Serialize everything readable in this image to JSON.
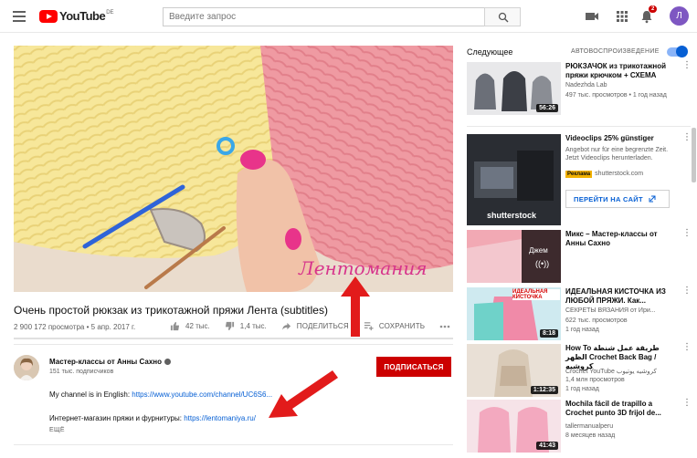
{
  "header": {
    "logo_text": "YouTube",
    "logo_region": "DE",
    "search_placeholder": "Введите запрос",
    "notification_count": "2",
    "avatar_letter": "Л",
    "colors": {
      "brand": "#ff0000",
      "avatar": "#7e57c2"
    }
  },
  "video": {
    "watermark": "Лентомания",
    "title": "Очень простой рюкзак из трикотажной пряжи Лента (subtitles)",
    "views": "2 900 172 просмотра",
    "date": "5 апр. 2017 г.",
    "likes": "42 тыс.",
    "dislikes": "1,4 тыс.",
    "share_label": "ПОДЕЛИТЬСЯ",
    "save_label": "СОХРАНИТЬ",
    "progress": 0
  },
  "channel": {
    "name": "Мастер-классы от Анны Сахно",
    "subscribers": "151 тыс. подписчиков",
    "subscribe_label": "ПОДПИСАТЬСЯ",
    "desc_line1_text": "My channel is in English: ",
    "desc_line1_link": "https://www.youtube.com/channel/UC6S6...",
    "desc_line2_text": "Интернет-магазин пряжи и фурнитуры: ",
    "desc_line2_link": "https://lentomaniya.ru/",
    "more_label": "ЕЩЁ"
  },
  "sidebar": {
    "up_next": "Следующее",
    "autoplay": "АВТОВОСПРОИЗВЕДЕНИЕ",
    "autoplay_on": true,
    "items": [
      {
        "title": "РЮКЗАЧОК из трикотажной пряжи крючком + СХЕМА",
        "channel": "Nadezhda Lab",
        "meta": "497 тыс. просмотров • 1 год назад",
        "duration": "56:26"
      },
      {
        "title": "Videoclips 25% günstiger",
        "description": "Angebot nur für eine begrenzte Zeit. Jetzt Videoclips herunterladen.",
        "ad_label": "Реклама",
        "advertiser": "shutterstock.com",
        "cta": "ПЕРЕЙТИ НА САЙТ",
        "thumb_text": "shutterstock"
      },
      {
        "title": "Микс – Мастер-классы от Анны Сахно",
        "mix_label": "Джем"
      },
      {
        "title": "ИДЕАЛЬНАЯ КИСТОЧКА ИЗ ЛЮБОЙ ПРЯЖИ. Как...",
        "channel": "СЕКРЕТЫ ВЯЗАНИЯ от Ири...",
        "meta": "622 тыс. просмотров",
        "meta2": "1 год назад",
        "duration": "8:18",
        "thumb_text": "ИДЕАЛЬНАЯ КИСТОЧКА"
      },
      {
        "title": "How To طريقة عمل شنطة الظهر Crochet Back Bag / كروشيه",
        "channel": "Crochet YouTube كروشيه يوتيوب",
        "meta": "1,4 млн просмотров",
        "meta2": "1 год назад",
        "duration": "1:12:35"
      },
      {
        "title": "Mochila fácil de trapillo a Crochet punto 3D frijol de...",
        "channel": "tallermanualperu",
        "meta": "8 месяцев назад",
        "duration": "41:43"
      }
    ]
  }
}
